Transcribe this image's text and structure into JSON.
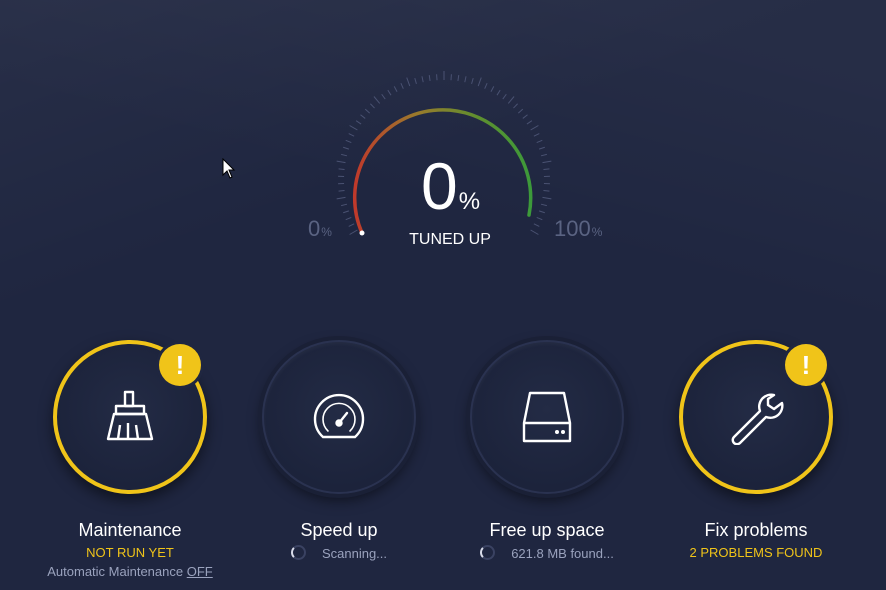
{
  "colors": {
    "background": "#1f2640",
    "warning": "#f0c419",
    "muted": "#9aa2bd",
    "scale": "#5a6382"
  },
  "gauge": {
    "value": "0",
    "unit": "%",
    "caption": "TUNED UP",
    "min": "0",
    "min_unit": "%",
    "max": "100",
    "max_unit": "%",
    "level": 0
  },
  "tiles": [
    {
      "title": "Maintenance",
      "status": "NOT RUN YET",
      "sub_label": "Automatic Maintenance",
      "sub_link": "OFF",
      "icon": "broom-icon",
      "badge": "!"
    },
    {
      "title": "Speed up",
      "status": "Scanning...",
      "icon": "speedometer-icon"
    },
    {
      "title": "Free up space",
      "status": "621.8 MB found...",
      "icon": "hard-drive-icon"
    },
    {
      "title": "Fix problems",
      "status": "2 PROBLEMS FOUND",
      "icon": "wrench-icon",
      "badge": "!"
    }
  ]
}
